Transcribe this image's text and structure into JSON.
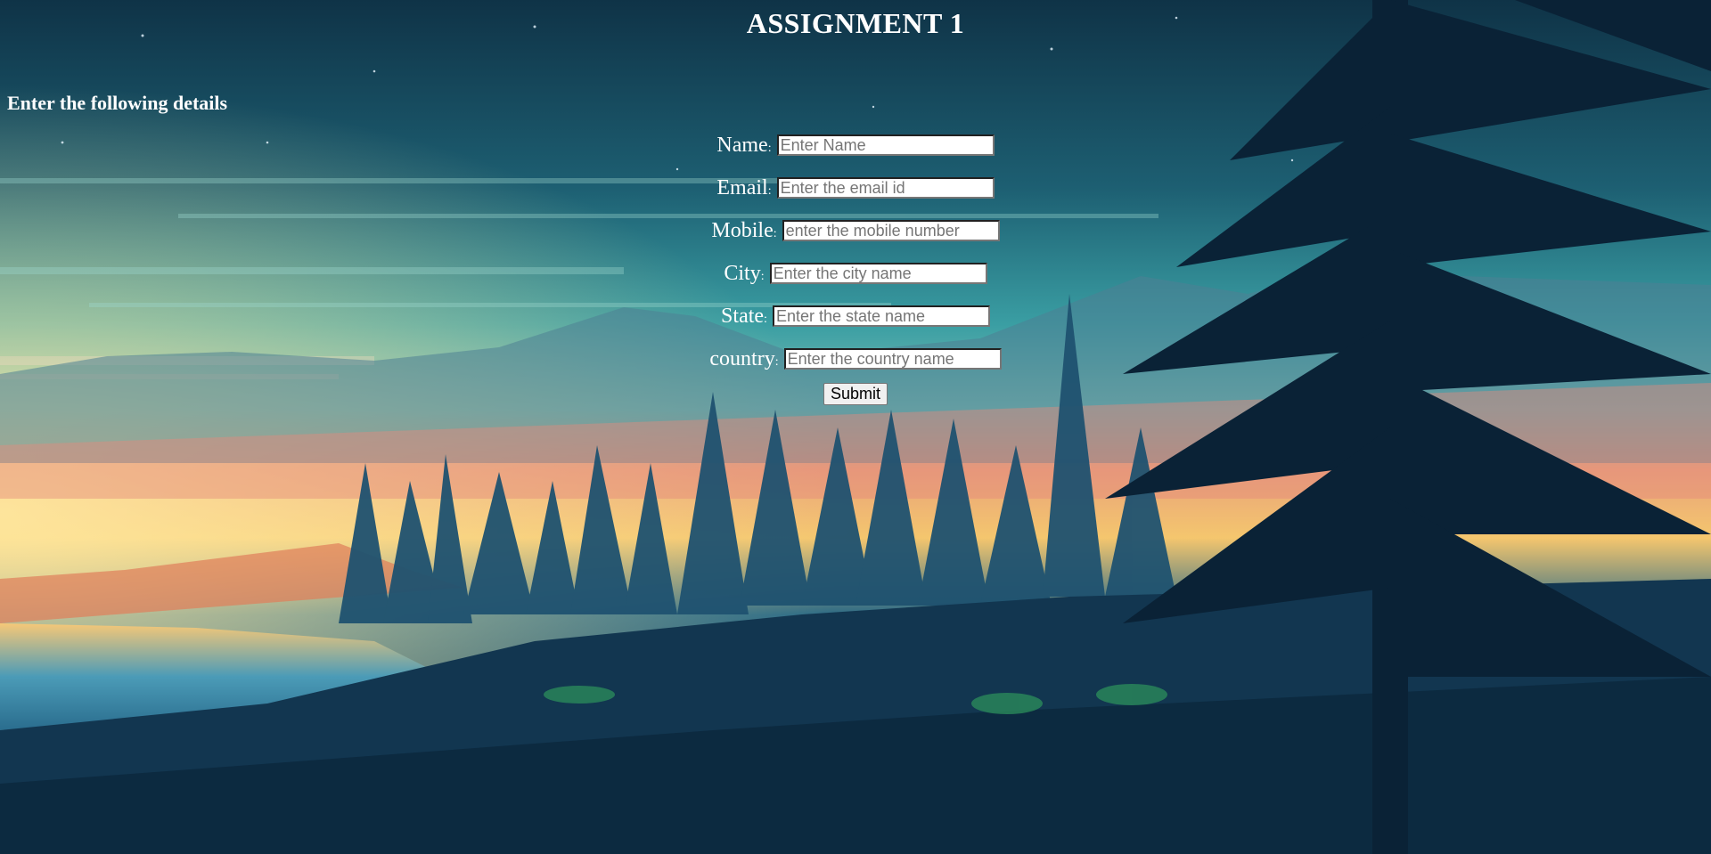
{
  "page": {
    "title": "ASSIGNMENT 1",
    "subheading": "Enter the following details"
  },
  "form": {
    "fields": [
      {
        "label": "Name",
        "placeholder": "Enter Name"
      },
      {
        "label": "Email",
        "placeholder": "Enter the email id"
      },
      {
        "label": "Mobile",
        "placeholder": "enter the mobile number"
      },
      {
        "label": "City",
        "placeholder": "Enter the city name"
      },
      {
        "label": "State",
        "placeholder": "Enter the state name"
      },
      {
        "label": "country",
        "placeholder": "Enter the country name"
      }
    ],
    "label_separator": ":",
    "submit_label": "Submit"
  },
  "background": {
    "description_icon": "forest-sunset-landscape",
    "colors": {
      "sky_top": "#0f3a52",
      "sky_mid": "#2f8e9a",
      "sunset_orange": "#f2a15a",
      "sunset_yellow": "#f7d36a",
      "forest_dark": "#0a2236",
      "water": "#3f8fb0"
    }
  }
}
